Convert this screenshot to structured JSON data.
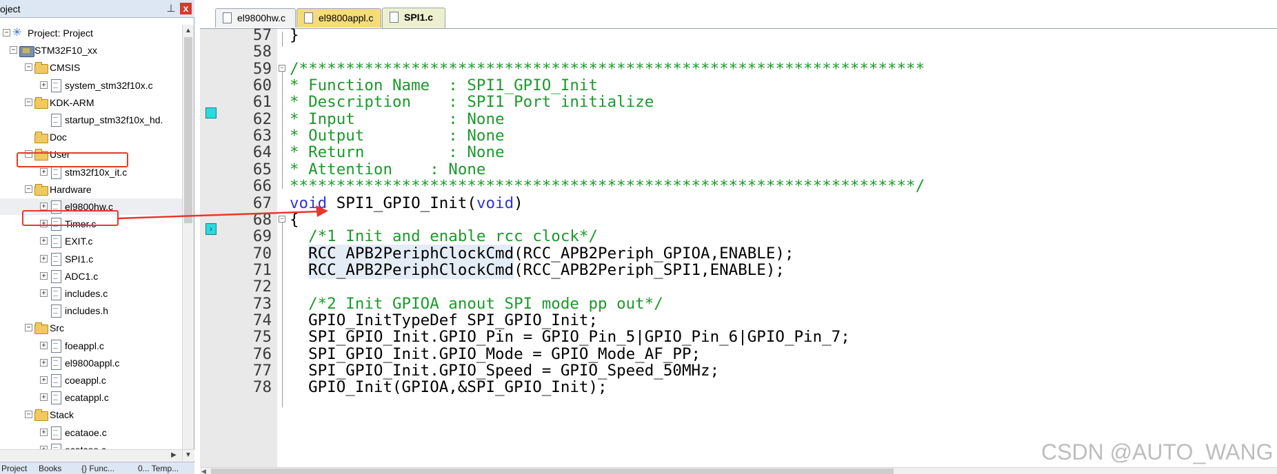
{
  "project_panel": {
    "title": "oject",
    "pin_icon": "pin-icon",
    "close_label": "x",
    "tree": [
      {
        "id": "project",
        "label": "Project: Project",
        "icon": "project-icon",
        "expander": "−"
      },
      {
        "id": "target",
        "label": "STM32F10_xx",
        "icon": "target-icon",
        "expander": "−"
      },
      {
        "id": "cmsis",
        "label": "CMSIS",
        "icon": "folder-icon",
        "expander": "−"
      },
      {
        "id": "system",
        "label": "system_stm32f10x.c",
        "icon": "file-icon",
        "expander": "+"
      },
      {
        "id": "kdk",
        "label": "KDK-ARM",
        "icon": "folder-icon",
        "expander": "−"
      },
      {
        "id": "startup",
        "label": "startup_stm32f10x_hd.",
        "icon": "file-icon",
        "expander": ""
      },
      {
        "id": "doc",
        "label": "Doc",
        "icon": "folder-icon",
        "expander": ""
      },
      {
        "id": "user",
        "label": "User",
        "icon": "folder-icon",
        "expander": "−"
      },
      {
        "id": "it",
        "label": "stm32f10x_it.c",
        "icon": "file-icon",
        "expander": "+"
      },
      {
        "id": "hardware",
        "label": "Hardware",
        "icon": "folder-icon",
        "expander": "−"
      },
      {
        "id": "el9800hw",
        "label": "el9800hw.c",
        "icon": "file-icon",
        "expander": "+"
      },
      {
        "id": "timer",
        "label": "Timer.c",
        "icon": "file-icon",
        "expander": "+"
      },
      {
        "id": "exit",
        "label": "EXIT.c",
        "icon": "file-icon",
        "expander": "+"
      },
      {
        "id": "spi1",
        "label": "SPI1.c",
        "icon": "file-icon",
        "expander": "+"
      },
      {
        "id": "adc1",
        "label": "ADC1.c",
        "icon": "file-icon",
        "expander": "+"
      },
      {
        "id": "includes_c",
        "label": "includes.c",
        "icon": "file-icon",
        "expander": "+"
      },
      {
        "id": "includes_h",
        "label": "includes.h",
        "icon": "file-icon",
        "expander": ""
      },
      {
        "id": "src",
        "label": "Src",
        "icon": "folder-icon",
        "expander": "−"
      },
      {
        "id": "foeappl",
        "label": "foeappl.c",
        "icon": "file-icon",
        "expander": "+"
      },
      {
        "id": "el9800appl_tree",
        "label": "el9800appl.c",
        "icon": "file-icon",
        "expander": "+"
      },
      {
        "id": "coeappl",
        "label": "coeappl.c",
        "icon": "file-icon",
        "expander": "+"
      },
      {
        "id": "ecatappl",
        "label": "ecatappl.c",
        "icon": "file-icon",
        "expander": "+"
      },
      {
        "id": "stack",
        "label": "Stack",
        "icon": "folder-icon",
        "expander": "−"
      },
      {
        "id": "ecataoe",
        "label": "ecataoe.c",
        "icon": "file-icon",
        "expander": "+"
      },
      {
        "id": "ecatcoe",
        "label": "ecatcoe.c",
        "icon": "file-icon",
        "expander": "+"
      }
    ],
    "bottom_tabs": [
      "Project",
      "Books",
      "{} Func...",
      "0... Temp..."
    ]
  },
  "editor": {
    "tabs": [
      {
        "label": "el9800hw.c",
        "active": false,
        "color": "#f3f3f3"
      },
      {
        "label": "el9800appl.c",
        "active": false,
        "color": "#f5dc7a"
      },
      {
        "label": "SPI1.c",
        "active": true,
        "color": "#ecf0ce"
      }
    ],
    "lines": [
      {
        "n": "57",
        "code": "}",
        "type": "plain"
      },
      {
        "n": "58",
        "code": "",
        "type": "plain"
      },
      {
        "n": "59",
        "code": "/*******************************************************************",
        "type": "comment"
      },
      {
        "n": "60",
        "code": "* Function Name  : SPI1_GPIO_Init",
        "type": "comment"
      },
      {
        "n": "61",
        "code": "* Description    : SPI1 Port initialize",
        "type": "comment"
      },
      {
        "n": "62",
        "code": "* Input          : None",
        "type": "comment"
      },
      {
        "n": "63",
        "code": "* Output         : None",
        "type": "comment"
      },
      {
        "n": "64",
        "code": "* Return         : None",
        "type": "comment"
      },
      {
        "n": "65",
        "code": "* Attention    : None",
        "type": "comment"
      },
      {
        "n": "66",
        "code": "*******************************************************************/",
        "type": "comment"
      },
      {
        "n": "67",
        "code": "void SPI1_GPIO_Init(void)",
        "type": "funcdef"
      },
      {
        "n": "68",
        "code": "{",
        "type": "plain"
      },
      {
        "n": "69",
        "code": "  /*1 Init and enable rcc clock*/",
        "type": "comment"
      },
      {
        "n": "70",
        "code": "  RCC_APB2PeriphClockCmd(RCC_APB2Periph_GPIOA,ENABLE);",
        "type": "hlcall",
        "hl": "RCC_APB2PeriphClockCmd",
        "rest": "(RCC_APB2Periph_GPIOA,ENABLE);"
      },
      {
        "n": "71",
        "code": "  RCC_APB2PeriphClockCmd(RCC_APB2Periph_SPI1,ENABLE);",
        "type": "hlcall",
        "hl": "RCC_APB2PeriphClockCmd",
        "rest": "(RCC_APB2Periph_SPI1,ENABLE);"
      },
      {
        "n": "72",
        "code": "",
        "type": "plain"
      },
      {
        "n": "73",
        "code": "  /*2 Init GPIOA anout SPI mode pp out*/",
        "type": "comment"
      },
      {
        "n": "74",
        "code": "  GPIO_InitTypeDef SPI_GPIO_Init;",
        "type": "plain"
      },
      {
        "n": "75",
        "code": "  SPI_GPIO_Init.GPIO_Pin = GPIO_Pin_5|GPIO_Pin_6|GPIO_Pin_7;",
        "type": "plain"
      },
      {
        "n": "76",
        "code": "  SPI_GPIO_Init.GPIO_Mode = GPIO_Mode_AF_PP;",
        "type": "plain"
      },
      {
        "n": "77",
        "code": "  SPI_GPIO_Init.GPIO_Speed = GPIO_Speed_50MHz;",
        "type": "plain"
      },
      {
        "n": "78",
        "code": "  GPIO_Init(GPIOA,&SPI_GPIO_Init);",
        "type": "plain"
      }
    ],
    "funcdef": {
      "kw1": "void",
      "name": " SPI1_GPIO_Init(",
      "kw2": "void",
      "close": ")"
    }
  },
  "annotations": {
    "color": "#e8362b"
  },
  "watermark": "CSDN @AUTO_WANG"
}
